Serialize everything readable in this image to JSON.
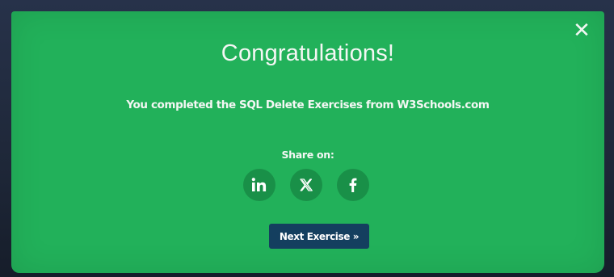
{
  "modal": {
    "close_glyph": "✕",
    "title": "Congratulations!",
    "message": "You completed the SQL Delete Exercises from W3Schools.com",
    "share_label": "Share on:",
    "share_buttons": [
      {
        "icon": "linkedin-icon",
        "glyph": "in"
      },
      {
        "icon": "x-twitter-icon",
        "glyph": "𝕏"
      },
      {
        "icon": "facebook-icon",
        "glyph": "f"
      }
    ],
    "next_label": "Next Exercise »"
  },
  "colors": {
    "modal_background": "#22b15a",
    "next_button": "#143f5f",
    "text": "#f4f7f4"
  }
}
